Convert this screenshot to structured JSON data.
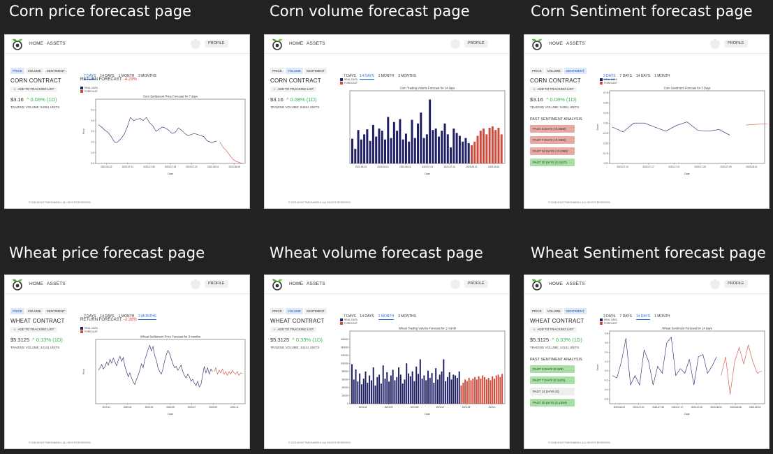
{
  "common": {
    "nav_home": "HOME",
    "nav_assets": "ASSETS",
    "nav_profile": "PROFILE",
    "asset_tabs": [
      "PRICE",
      "VOLUME",
      "SENTIMENT"
    ],
    "tracking_button": "ADD TO TRACKING LIST",
    "legend_real": "REAL DATA",
    "legend_forecast": "FORECAST",
    "footer": "© 2023 MONT PARONMESHI. ALL RIGHTS RESERVED.",
    "sentiment_heading": "PAST SENTIMENT ANALYSIS",
    "colors": {
      "real": "#1f1f66",
      "forecast": "#d04a3a",
      "active_tab": "#2a6fd6",
      "positive": "#39b54a",
      "negative": "#e03c31",
      "chip_red": "#e8a9a4",
      "chip_green": "#a8e0a3",
      "chip_gray": "#eeeeee"
    }
  },
  "panels": [
    {
      "title": "Corn price forecast page",
      "active_asset_tab": 0,
      "contract": "CORN CONTRACT",
      "price": "$3.16",
      "change": "^ 0.08% (1D)",
      "volume_text": "TRADING VOLUME: 64361 UNITS",
      "return_label": "RETURN FORECAST:",
      "return_value": "-4.29%",
      "periods": [
        "7 DAYS",
        "14 DAYS",
        "1 MONTH",
        "3 MONTHS"
      ],
      "active_period": 0,
      "chart_data": {
        "type": "line",
        "title": "Corn Settlement Price Forecast for 7 days",
        "xlabel": "Date",
        "ylabel": "Price",
        "ylim": [
          0,
          6
        ],
        "yticks": [
          "0.0",
          "1.0",
          "2.0",
          "3.0",
          "4.0",
          "5.0"
        ],
        "xticks": [
          "2023-06-22",
          "2023-07-01",
          "2023-07-08",
          "2023-07-15",
          "2023-07-22",
          "2023-08-01",
          "2023-08-08"
        ],
        "series": [
          {
            "name": "REAL DATA",
            "values": [
              3.6,
              3.4,
              3.1,
              2.9,
              2.5,
              2.0,
              2.0,
              2.3,
              2.7,
              3.4,
              4.3,
              4.0,
              4.1,
              4.2,
              4.0,
              4.3,
              3.8,
              3.5,
              3.0,
              3.2,
              3.4,
              3.3,
              3.1,
              2.8,
              2.9,
              3.3,
              3.1,
              2.8,
              2.6,
              2.7,
              2.8,
              2.7,
              2.6,
              2.5,
              2.1,
              2.0,
              2.0,
              2.1
            ]
          },
          {
            "name": "FORECAST",
            "values": [
              2.0,
              1.5,
              1.2,
              0.8,
              0.4,
              0.2,
              0.1,
              0.0
            ]
          }
        ]
      }
    },
    {
      "title": "Corn volume forecast page",
      "active_asset_tab": 1,
      "contract": "CORN CONTRACT",
      "price": "$3.16",
      "change": "^ 0.08% (1D)",
      "volume_text": "TRADING VOLUME: 64361 UNITS",
      "periods": [
        "7 DAYS",
        "14 DAYS",
        "1 MONTH",
        "3 MONTHS"
      ],
      "active_period": 1,
      "chart_data": {
        "type": "bar",
        "title": "Corn Trading Volume Forecast for 14 days",
        "xlabel": "Date",
        "ylabel": "",
        "ylim": [
          0,
          100
        ],
        "xticks": [
          "2023-05-15",
          "2023-06-01",
          "2023-06-15",
          "2023-07-01",
          "2023-07-15",
          "2023-08-01",
          "2023-08-15"
        ],
        "series": [
          {
            "name": "REAL DATA",
            "values": [
              34,
              20,
              46,
              33,
              40,
              47,
              31,
              53,
              37,
              48,
              45,
              33,
              64,
              35,
              57,
              45,
              61,
              33,
              41,
              30,
              60,
              35,
              55,
              70,
              35,
              40,
              88,
              46,
              48,
              37,
              45,
              55,
              40,
              22,
              48,
              42,
              38,
              30,
              35,
              28
            ]
          },
          {
            "name": "FORECAST",
            "values": [
              25,
              30,
              38,
              45,
              48,
              40,
              49,
              51,
              46,
              49,
              40
            ]
          }
        ]
      }
    },
    {
      "title": "Corn Sentiment forecast page",
      "active_asset_tab": 2,
      "contract": "CORN CONTRACT",
      "price": "$3.16",
      "change": "^ 0.08% (1D)",
      "volume_text": "TRADING VOLUME: 64361 UNITS",
      "periods": [
        "3 DAYS",
        "7 DAYS",
        "14 DAYS",
        "1 MONTH"
      ],
      "active_period": 0,
      "sentiment_chips": [
        {
          "label": "PAST 3 DAYS (-0.2988)",
          "tone": "red"
        },
        {
          "label": "PAST 7 DAYS (-0.1965)",
          "tone": "red"
        },
        {
          "label": "PAST 14 DAYS (-0.1386)",
          "tone": "red"
        },
        {
          "label": "PAST 30 DAYS (0.0107)",
          "tone": "green"
        }
      ],
      "chart_data": {
        "type": "line",
        "title": "Corn Sentiment Forecast for 3 Days",
        "xlabel": "Date",
        "ylabel": "Score",
        "ylim": [
          -1.0,
          0.8
        ],
        "yticks": [
          "0.75",
          "0.50",
          "0.25",
          "0.00",
          "-0.25",
          "-0.50",
          "-0.75",
          "-1.00"
        ],
        "xticks": [
          "2023-07-13",
          "2023-07-17",
          "2023-07-21",
          "2023-07-25",
          "2023-07-29",
          "2023-08-01"
        ],
        "series": [
          {
            "name": "REAL DATA",
            "values": [
              -0.1,
              -0.22,
              0.0,
              0.0,
              -0.1,
              -0.2,
              -0.06,
              0.03,
              -0.18,
              -0.2,
              -0.16,
              -0.3
            ]
          },
          {
            "name": "FORECAST",
            "values": [
              -0.05,
              -0.03,
              -0.02
            ]
          }
        ]
      }
    },
    {
      "title": "Wheat price forecast page",
      "active_asset_tab": 0,
      "contract": "WHEAT CONTRACT",
      "price": "$5.3125",
      "change": "^ 0.33% (1D)",
      "volume_text": "TRADING VOLUME: 44131 UNITS",
      "return_label": "RETURN FORECAST:",
      "return_value": "-2.39%",
      "periods": [
        "7 DAYS",
        "14 DAYS",
        "1 MONTH",
        "3 MONTHS"
      ],
      "active_period": 3,
      "chart_data": {
        "type": "line",
        "title": "Wheat Settlement Price Forecast for 3 months",
        "xlabel": "Date",
        "ylabel": "Price",
        "ylim": [
          0,
          10
        ],
        "xticks": [
          "2019-11",
          "2020-01",
          "2020-03",
          "2020-05",
          "2020-07",
          "2020-09",
          "2020-11"
        ],
        "series": [
          {
            "name": "REAL DATA",
            "values": [
              5.2,
              5.6,
              6.1,
              5.4,
              5.8,
              6.5,
              6.0,
              6.9,
              6.3,
              7.1,
              6.5,
              5.9,
              6.8,
              7.4,
              6.6,
              7.2,
              5.8,
              5.0,
              4.2,
              4.8,
              4.0,
              3.4,
              3.0,
              3.8,
              4.4,
              5.2,
              6.2,
              5.6,
              6.8,
              7.6,
              8.4,
              9.1,
              8.2,
              8.9,
              7.5,
              6.8,
              5.6,
              5.0,
              4.6,
              5.4,
              6.6,
              7.6,
              8.3,
              7.8,
              7.0,
              6.2,
              5.6,
              5.8,
              5.2,
              5.6,
              6.0,
              5.0,
              4.4,
              4.0,
              4.6,
              4.2,
              3.5,
              3.8,
              3.2,
              2.8,
              3.5,
              2.6,
              3.0,
              4.4,
              5.8,
              4.8,
              5.6,
              4.6,
              5.4,
              5.0
            ]
          },
          {
            "name": "FORECAST",
            "values": [
              5.0,
              5.6,
              4.6,
              5.2,
              4.8,
              5.4,
              4.6,
              5.0,
              4.4,
              5.0,
              4.6,
              5.2,
              4.8,
              4.6,
              5.0,
              4.4,
              4.8,
              4.7
            ]
          }
        ]
      }
    },
    {
      "title": "Wheat volume forecast page",
      "active_asset_tab": 1,
      "contract": "WHEAT CONTRACT",
      "price": "$5.3125",
      "change": "^ 0.33% (1D)",
      "volume_text": "TRADING VOLUME: 44131 UNITS",
      "periods": [
        "7 DAYS",
        "14 DAYS",
        "1 MONTH",
        "3 MONTHS"
      ],
      "active_period": 2,
      "chart_data": {
        "type": "bar",
        "title": "Wheat Trading Volume Forecast for 1 month",
        "xlabel": "Date",
        "ylabel": "",
        "ylim": [
          0,
          180000
        ],
        "yticks": [
          "0",
          "20000",
          "40000",
          "60000",
          "80000",
          "100000",
          "120000",
          "140000",
          "160000"
        ],
        "xticks": [
          "2023-04",
          "2023-05",
          "2023-06",
          "2023-07",
          "2023-08",
          "2023-0"
        ],
        "series": [
          {
            "name": "REAL DATA",
            "values": [
              98000,
              60000,
              85000,
              55000,
              75000,
              48000,
              62000,
              80000,
              52000,
              70000,
              58000,
              90000,
              45000,
              66000,
              72000,
              50000,
              95000,
              62000,
              78000,
              55000,
              70000,
              84000,
              58000,
              66000,
              90000,
              72000,
              50000,
              60000,
              100000,
              75000,
              68000,
              80000,
              56000,
              92000,
              74000,
              110000,
              62000,
              70000,
              58000,
              82000,
              64000,
              76000,
              52000,
              88000,
              60000,
              72000,
              80000,
              110000,
              56000,
              66000,
              78000,
              60000,
              72000,
              70000,
              64000,
              80000
            ]
          },
          {
            "name": "FORECAST",
            "values": [
              45000,
              52000,
              60000,
              56000,
              64000,
              58000,
              62000,
              66000,
              60000,
              68000,
              62000,
              70000,
              66000,
              60000,
              64000,
              58000,
              68000,
              62000,
              70000,
              72000,
              66000,
              74000
            ]
          }
        ]
      }
    },
    {
      "title": "Wheat Sentiment forecast page",
      "active_asset_tab": 2,
      "contract": "WHEAT CONTRACT",
      "price": "$5.3125",
      "change": "^ 0.33% (1D)",
      "volume_text": "TRADING VOLUME: 44131 UNITS",
      "periods": [
        "3 DAYS",
        "7 DAYS",
        "14 DAYS",
        "1 MONTH"
      ],
      "active_period": 2,
      "sentiment_chips": [
        {
          "label": "PAST 3 DAYS (0.129)",
          "tone": "green"
        },
        {
          "label": "PAST 7 DAYS (0.1423)",
          "tone": "green"
        },
        {
          "label": "PAST 14 DAYS (0)",
          "tone": "gray"
        },
        {
          "label": "PAST 30 DAYS (0.1394)",
          "tone": "green"
        }
      ],
      "chart_data": {
        "type": "line",
        "title": "Wheat Sentiment Forecast for 14 days",
        "xlabel": "Date",
        "ylabel": "Score",
        "ylim": [
          -0.7,
          0.85
        ],
        "yticks": [
          "0.8",
          "0.6",
          "0.4",
          "0.2",
          "0.0",
          "-0.2",
          "-0.4",
          "-0.6"
        ],
        "xticks": [
          "2023-06-22",
          "2023-07-01",
          "2023-07-08",
          "2023-07-17",
          "2023-07-22",
          "2023-08-01",
          "2023-08-08",
          "2023-08-15"
        ],
        "series": [
          {
            "name": "REAL DATA",
            "values": [
              -0.1,
              -0.15,
              0.2,
              0.7,
              -0.3,
              -0.1,
              -0.3,
              0.45,
              0.2,
              -0.3,
              0.1,
              -0.05,
              0.6,
              0.72,
              -0.1,
              0.05,
              -0.05,
              0.25,
              -0.3,
              0.3,
              0.35,
              -0.05,
              0.1,
              0.3
            ]
          },
          {
            "name": "FORECAST",
            "values": [
              -0.1,
              0.3,
              -0.5,
              0.2,
              0.5,
              0.15,
              0.55,
              0.2,
              -0.05,
              0.0
            ]
          }
        ]
      }
    }
  ]
}
